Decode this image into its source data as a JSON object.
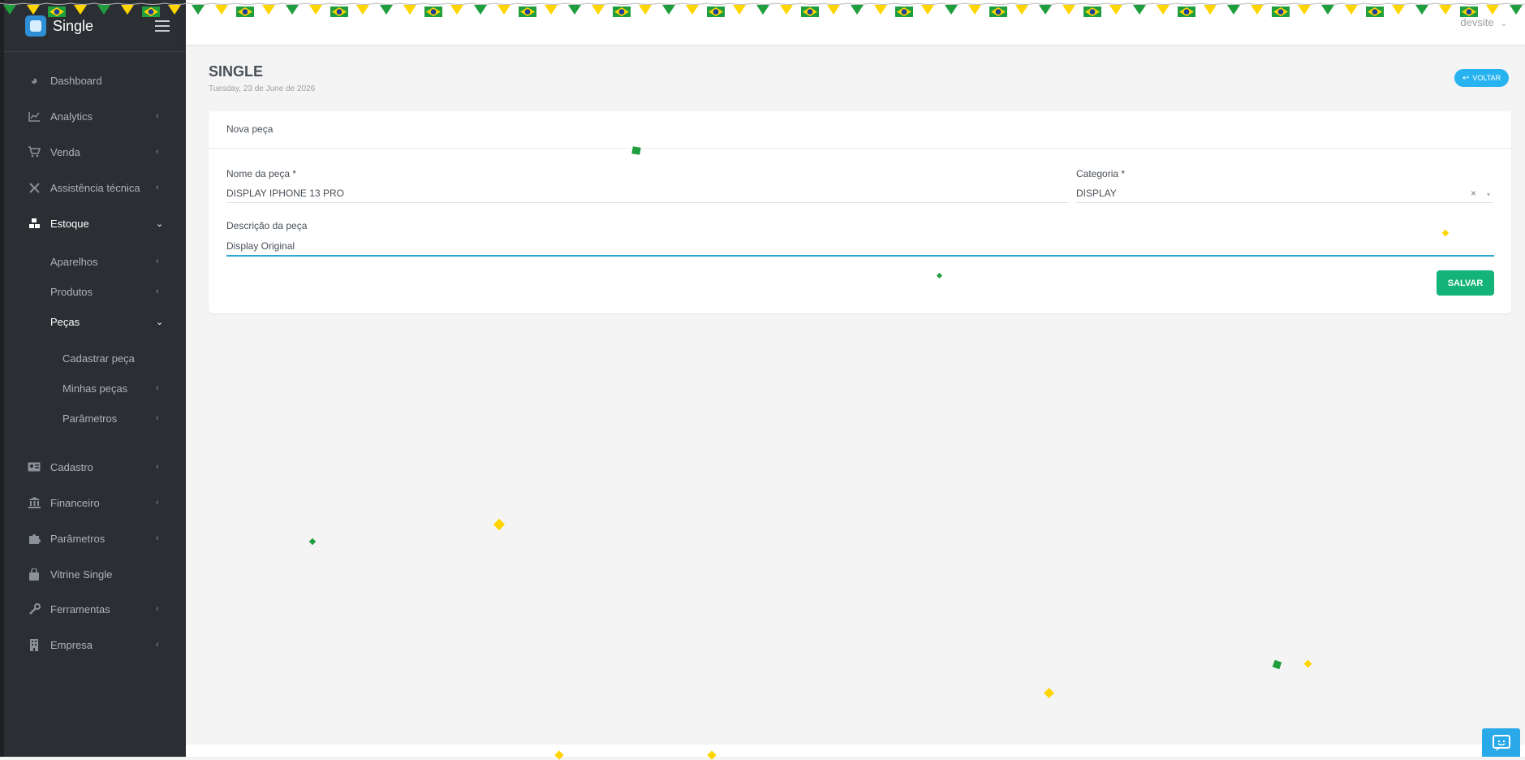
{
  "brand": {
    "name": "Single"
  },
  "sidebar": {
    "items": [
      {
        "label": "Dashboard",
        "icon": "pie-chart-icon",
        "chevron": ""
      },
      {
        "label": "Analytics",
        "icon": "line-chart-icon",
        "chevron": "‹"
      },
      {
        "label": "Venda",
        "icon": "cart-icon",
        "chevron": "‹"
      },
      {
        "label": "Assistência técnica",
        "icon": "tools-icon",
        "chevron": "‹"
      },
      {
        "label": "Estoque",
        "icon": "boxes-icon",
        "chevron": "⌄"
      },
      {
        "label": "Aparelhos",
        "chevron": "‹"
      },
      {
        "label": "Produtos",
        "chevron": "‹"
      },
      {
        "label": "Peças",
        "chevron": "⌄"
      },
      {
        "label": "Cadastrar peça",
        "chevron": ""
      },
      {
        "label": "Minhas peças",
        "chevron": "‹"
      },
      {
        "label": "Parâmetros",
        "chevron": "‹"
      },
      {
        "label": "Cadastro",
        "icon": "id-card-icon",
        "chevron": "‹"
      },
      {
        "label": "Financeiro",
        "icon": "bank-icon",
        "chevron": "‹"
      },
      {
        "label": "Parâmetros",
        "icon": "puzzle-icon",
        "chevron": "‹"
      },
      {
        "label": "Vitrine Single",
        "icon": "bag-icon",
        "chevron": ""
      },
      {
        "label": "Ferramentas",
        "icon": "wrench-icon",
        "chevron": "‹"
      },
      {
        "label": "Empresa",
        "icon": "building-icon",
        "chevron": "‹"
      }
    ]
  },
  "topbar": {
    "user": "devsite",
    "caret": "⌄"
  },
  "header": {
    "title": "SINGLE",
    "date": "Tuesday, 23 de June de 2026",
    "back_label": "VOLTAR",
    "back_icon": "↩"
  },
  "form": {
    "card_title": "Nova peça",
    "name_label": "Nome da peça *",
    "name_value": "DISPLAY IPHONE 13 PRO",
    "category_label": "Categoria *",
    "category_value": "DISPLAY",
    "category_clear": "×",
    "category_arrow": "▾",
    "description_label": "Descrição da peça",
    "description_value": "Display Original",
    "save_label": "SALVAR"
  },
  "colors": {
    "sidebar_bg": "#2b2e33",
    "accent_blue": "#26b3f0",
    "save_green": "#13b37a",
    "flag_green": "#1f9e3d",
    "flag_yellow": "#ffd500",
    "flag_blue": "#1e3f99"
  }
}
